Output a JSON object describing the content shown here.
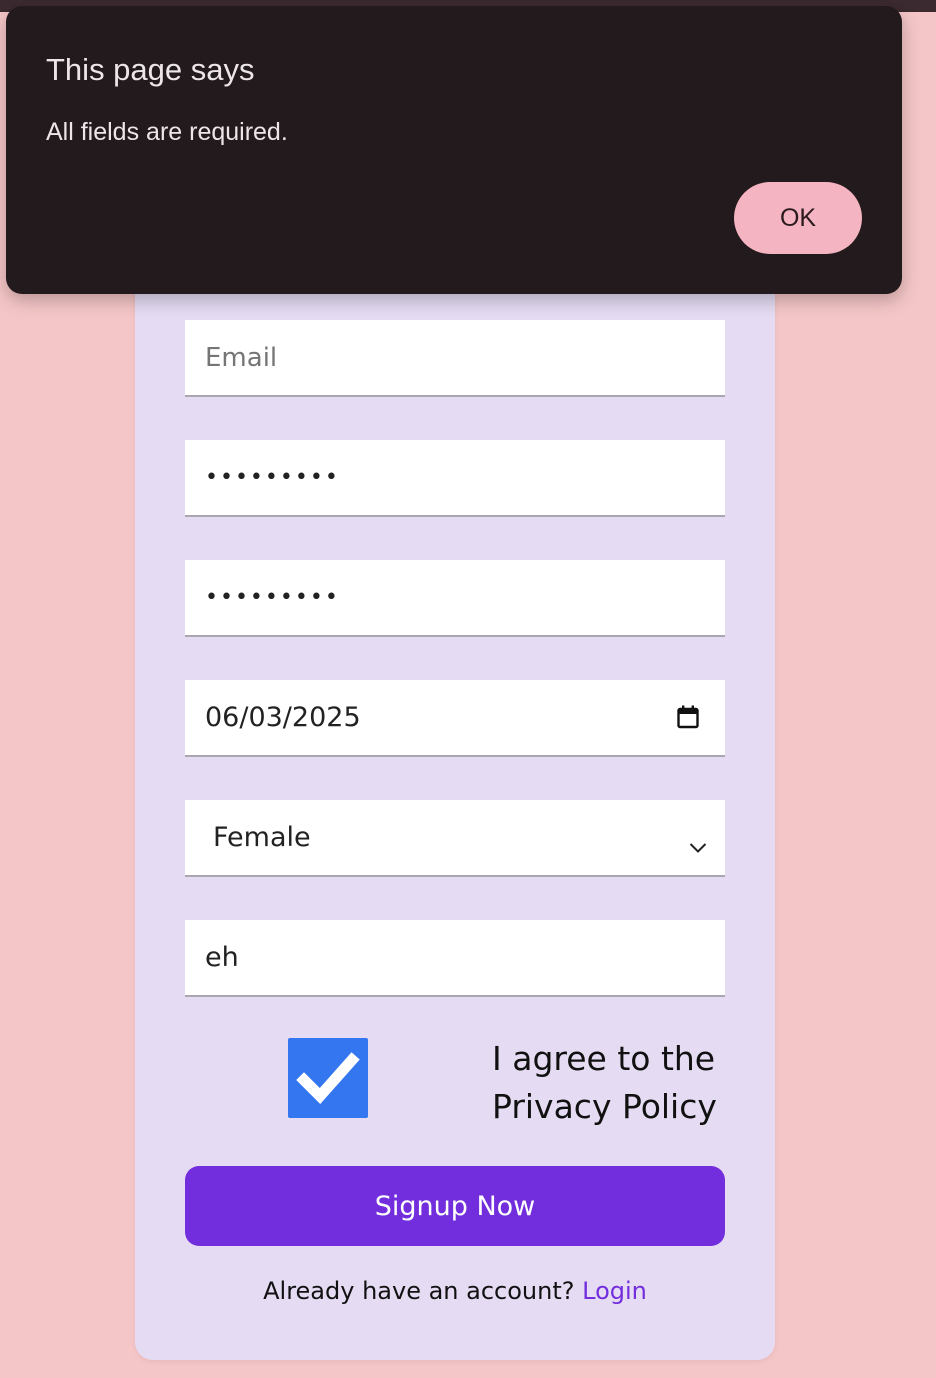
{
  "dialog": {
    "title": "This page says",
    "message": "All fields are required.",
    "ok_label": "OK"
  },
  "form": {
    "email": {
      "value": "",
      "placeholder": "Email"
    },
    "password": {
      "masked_value": "•••••••••"
    },
    "confirm_password": {
      "masked_value": "•••••••••"
    },
    "dob": {
      "value": "06/03/2025"
    },
    "gender": {
      "selected": "Female"
    },
    "extra": {
      "value": "eh"
    },
    "agree": {
      "checked": true,
      "label": "I agree to the Privacy Policy"
    },
    "submit_label": "Signup Now",
    "login_prompt": "Already have an account?",
    "login_link": "Login"
  },
  "icons": {
    "date": "calendar-icon",
    "select": "chevron-down-icon",
    "check": "checkmark-icon"
  },
  "colors": {
    "page_bg": "#f5c6c7",
    "card_bg": "#e5dcf3",
    "accent": "#722edc",
    "checkbox": "#3376f0",
    "dialog_bg": "#221a1c",
    "ok_button": "#f4b4c1"
  }
}
